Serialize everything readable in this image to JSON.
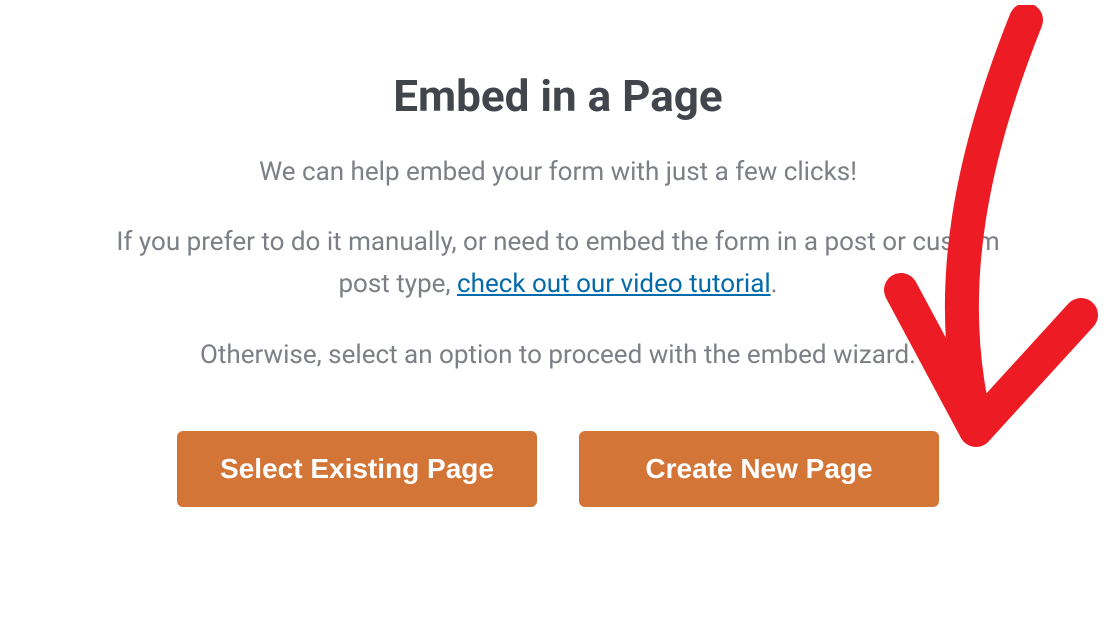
{
  "modal": {
    "title": "Embed in a Page",
    "subtitle": "We can help embed your form with just a few clicks!",
    "description_prefix": "If you prefer to do it manually, or need to embed the form in a post or custom post type, ",
    "link_text": "check out our video tutorial",
    "description_suffix": ".",
    "footer_text": "Otherwise, select an option to proceed with the embed wizard.",
    "select_existing_label": "Select Existing Page",
    "create_new_label": "Create New Page"
  }
}
